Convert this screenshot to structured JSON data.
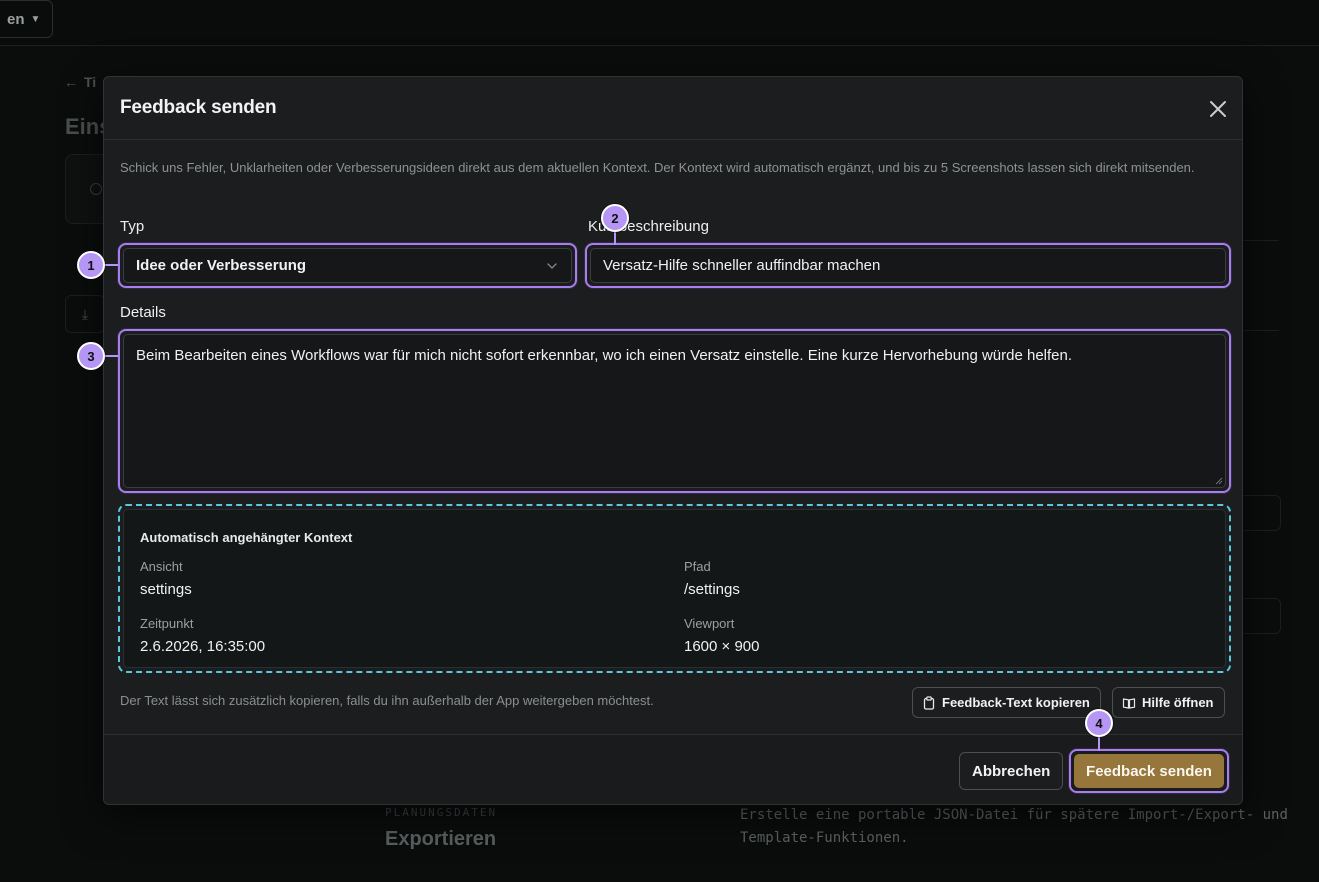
{
  "background": {
    "menu_label": "en",
    "back_label": "Ti",
    "page_title": "Eins",
    "section_label": "PLANUNGSDATEN",
    "section_title": "Exportieren",
    "section_desc": "Erstelle eine portable JSON-Datei für spätere Import-/Export- und Template-Funktionen."
  },
  "modal": {
    "title": "Feedback senden",
    "intro": "Schick uns Fehler, Unklarheiten oder Verbesserungsideen direkt aus dem aktuellen Kontext. Der Kontext wird automatisch ergänzt, und bis zu 5 Screenshots lassen sich direkt mitsenden.",
    "type_label": "Typ",
    "type_value": "Idee oder Verbesserung",
    "summary_label": "Kurzbeschreibung",
    "summary_value": "Versatz-Hilfe schneller auffindbar machen",
    "details_label": "Details",
    "details_value": "Beim Bearbeiten eines Workflows war für mich nicht sofort erkennbar, wo ich einen Versatz einstelle. Eine kurze Hervorhebung würde helfen.",
    "context": {
      "title": "Automatisch angehängter Kontext",
      "view_label": "Ansicht",
      "view_value": "settings",
      "path_label": "Pfad",
      "path_value": "/settings",
      "time_label": "Zeitpunkt",
      "time_value": "2.6.2026, 16:35:00",
      "viewport_label": "Viewport",
      "viewport_value": "1600 × 900"
    },
    "copy_note": "Der Text lässt sich zusätzlich kopieren, falls du ihn außerhalb der App weitergeben möchtest.",
    "copy_button": "Feedback-Text kopieren",
    "help_button": "Hilfe öffnen",
    "cancel_button": "Abbrechen",
    "send_button": "Feedback senden"
  },
  "markers": [
    "1",
    "2",
    "3",
    "4"
  ],
  "colors": {
    "highlight": "#a87df0",
    "marker": "#b596f4",
    "context_border": "#5ac7dd",
    "send_button": "#96763a"
  }
}
